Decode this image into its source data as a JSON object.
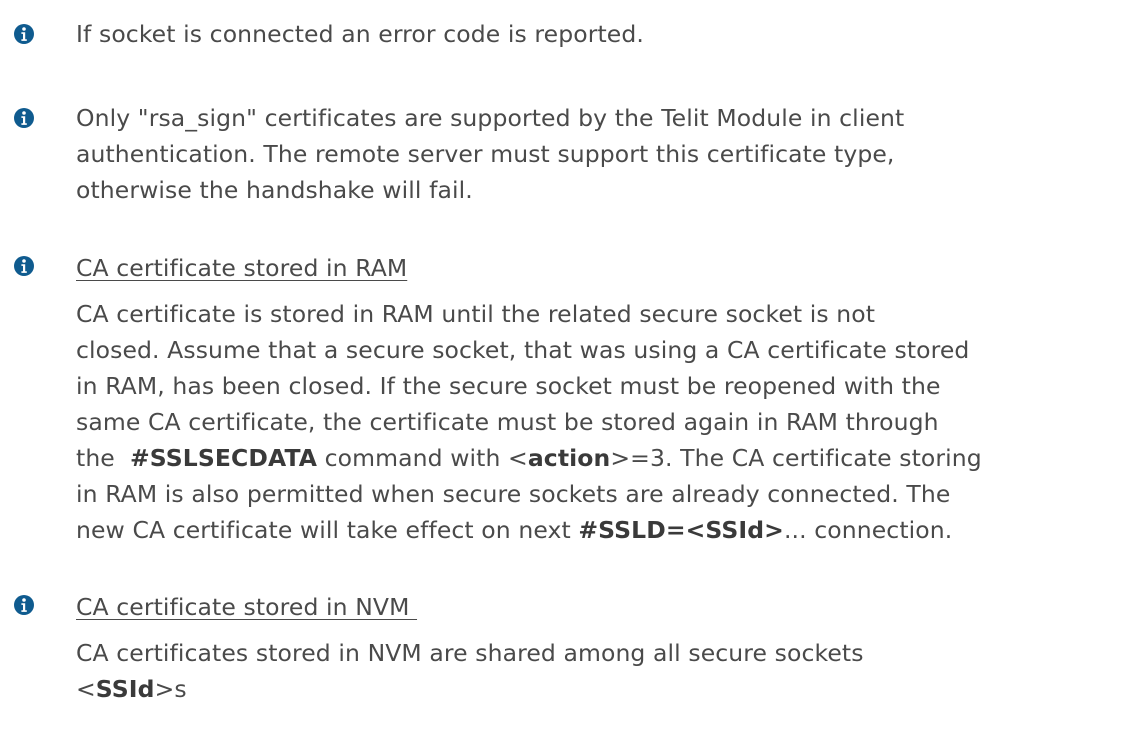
{
  "icon_color": "#0f5b8f",
  "notes": [
    {
      "icon": "info-icon",
      "lines": [
        "If socket is connected an error code is reported."
      ]
    },
    {
      "icon": "info-icon",
      "lines": [
        "Only \"rsa_sign\" certificates are supported by the Telit Module in client",
        "authentication. The remote server must support this certificate type,",
        "otherwise the handshake will fail."
      ]
    },
    {
      "icon": "info-icon",
      "title": "CA certificate stored in RAM",
      "lines": [
        "CA certificate is stored in RAM until the related secure socket is not",
        "closed. Assume that a secure socket, that was using a CA certificate stored",
        "in RAM, has been closed. If the secure socket must be reopened with the",
        "same CA certificate, the certificate must be stored again in RAM through"
      ],
      "line5": {
        "pre": "the  ",
        "cmd": "#SSLSECDATA",
        "mid": " command with <",
        "param": "action",
        "post": ">=3. The CA certificate storing"
      },
      "line6": "in RAM is also permitted when secure sockets are already connected. The",
      "line7": {
        "pre": "new CA certificate will take effect on next ",
        "cmd": "#SSLD=<SSId>",
        "post": "... connection."
      }
    },
    {
      "icon": "info-icon",
      "title": "CA certificate stored in NVM ",
      "line1": "CA certificates stored in NVM are shared among all secure sockets",
      "line2": {
        "pre": "<",
        "param": "SSId",
        "post": ">s"
      }
    }
  ]
}
